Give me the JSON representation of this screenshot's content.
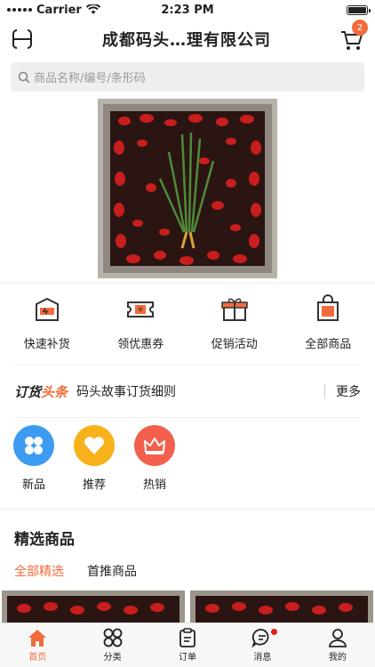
{
  "status_bar": {
    "carrier": "Carrier",
    "time": "2:23 PM"
  },
  "nav": {
    "title": "成都码头…理有限公司",
    "cart_count": "2"
  },
  "search": {
    "placeholder": "商品名称/编号/条形码"
  },
  "quick_actions": [
    {
      "label": "快速补货",
      "icon": "restock-box-icon"
    },
    {
      "label": "领优惠券",
      "icon": "coupon-icon"
    },
    {
      "label": "促销活动",
      "icon": "gift-icon"
    },
    {
      "label": "全部商品",
      "icon": "shopping-bag-icon"
    }
  ],
  "headline": {
    "logo_prefix": "订货",
    "logo_accent": "头条",
    "text": "码头故事订货细则",
    "more": "更多"
  },
  "categories": [
    {
      "label": "新品",
      "icon": "four-petal-icon",
      "color": "#3d9bf2"
    },
    {
      "label": "推荐",
      "icon": "heart-icon",
      "color": "#f7b21b"
    },
    {
      "label": "热销",
      "icon": "crown-icon",
      "color": "#f25f4c"
    }
  ],
  "featured": {
    "title": "精选商品",
    "tabs": [
      "全部精选",
      "首推商品"
    ]
  },
  "tab_bar": [
    {
      "label": "首页",
      "icon": "home-icon",
      "active": true
    },
    {
      "label": "分类",
      "icon": "category-icon",
      "active": false
    },
    {
      "label": "订单",
      "icon": "order-icon",
      "active": false
    },
    {
      "label": "消息",
      "icon": "message-icon",
      "active": false,
      "dot": true
    },
    {
      "label": "我的",
      "icon": "profile-icon",
      "active": false
    }
  ],
  "colors": {
    "accent": "#f26b3c",
    "notification_dot": "#e02020"
  }
}
